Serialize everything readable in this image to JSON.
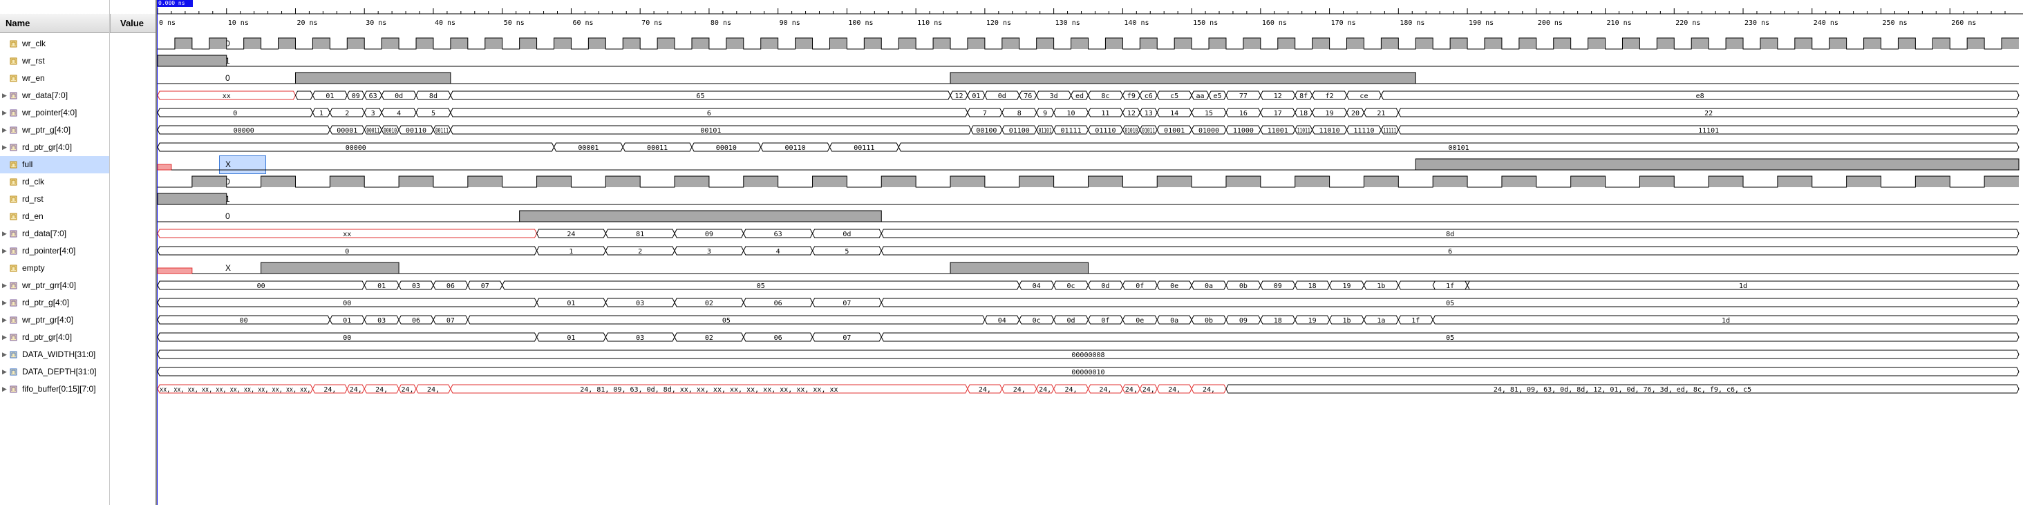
{
  "header": {
    "name_col": "Name",
    "value_col": "Value",
    "cursor_time": "0.000 ns"
  },
  "timeline": {
    "ticks": [
      "0 ns",
      "10 ns",
      "20 ns",
      "30 ns",
      "40 ns",
      "50 ns",
      "60 ns",
      "70 ns",
      "80 ns",
      "90 ns",
      "100 ns",
      "110 ns",
      "120 ns",
      "130 ns",
      "140 ns",
      "150 ns",
      "160 ns",
      "170 ns",
      "180 ns",
      "190 ns",
      "200 ns",
      "210 ns",
      "220 ns",
      "230 ns",
      "240 ns",
      "250 ns",
      "260 ns"
    ]
  },
  "signals": [
    {
      "name": "wr_clk",
      "value": "0",
      "kind": "clock",
      "half_period": 2.5,
      "start": 0,
      "expandable": false
    },
    {
      "name": "wr_rst",
      "value": "1",
      "kind": "bit",
      "segments": [
        [
          0,
          10,
          "1"
        ],
        [
          10,
          270,
          "0"
        ]
      ],
      "expandable": false
    },
    {
      "name": "wr_en",
      "value": "0",
      "kind": "bit",
      "segments": [
        [
          0,
          20,
          "0"
        ],
        [
          20,
          42.5,
          "1"
        ],
        [
          42.5,
          115,
          "0"
        ],
        [
          115,
          182.5,
          "1"
        ],
        [
          182.5,
          270,
          "0"
        ]
      ],
      "expandable": false
    },
    {
      "name": "wr_data[7:0]",
      "value": "XX",
      "kind": "bus",
      "expandable": true,
      "segments": [
        [
          0,
          20,
          "xx",
          true
        ],
        [
          20,
          22.5,
          "",
          false
        ],
        [
          22.5,
          27.5,
          "01"
        ],
        [
          27.5,
          30,
          "09"
        ],
        [
          30,
          32.5,
          "63"
        ],
        [
          32.5,
          37.5,
          "0d"
        ],
        [
          37.5,
          42.5,
          "8d"
        ],
        [
          42.5,
          115,
          "65"
        ],
        [
          115,
          117.5,
          "12"
        ],
        [
          117.5,
          120,
          "01"
        ],
        [
          120,
          125,
          "0d"
        ],
        [
          125,
          127.5,
          "76"
        ],
        [
          127.5,
          132.5,
          "3d"
        ],
        [
          132.5,
          135,
          "ed"
        ],
        [
          135,
          140,
          "8c"
        ],
        [
          140,
          142.5,
          "f9"
        ],
        [
          142.5,
          145,
          "c6"
        ],
        [
          145,
          150,
          "c5"
        ],
        [
          150,
          152.5,
          "aa"
        ],
        [
          152.5,
          155,
          "e5"
        ],
        [
          155,
          160,
          "77"
        ],
        [
          160,
          165,
          "12"
        ],
        [
          165,
          167.5,
          "8f"
        ],
        [
          167.5,
          172.5,
          "f2"
        ],
        [
          172.5,
          177.5,
          "ce"
        ],
        [
          177.5,
          270,
          "e8"
        ]
      ]
    },
    {
      "name": "wr_pointer[4:0]",
      "value": "0",
      "kind": "bus",
      "expandable": true,
      "segments": [
        [
          0,
          22.5,
          "0"
        ],
        [
          22.5,
          25,
          "1"
        ],
        [
          25,
          30,
          "2"
        ],
        [
          30,
          32.5,
          "3"
        ],
        [
          32.5,
          37.5,
          "4"
        ],
        [
          37.5,
          42.5,
          "5"
        ],
        [
          42.5,
          117.5,
          "6"
        ],
        [
          117.5,
          122.5,
          "7"
        ],
        [
          122.5,
          127.5,
          "8"
        ],
        [
          127.5,
          130,
          "9"
        ],
        [
          130,
          135,
          "10"
        ],
        [
          135,
          140,
          "11"
        ],
        [
          140,
          142.5,
          "12"
        ],
        [
          142.5,
          145,
          "13"
        ],
        [
          145,
          150,
          "14"
        ],
        [
          150,
          155,
          "15"
        ],
        [
          155,
          160,
          "16"
        ],
        [
          160,
          165,
          "17"
        ],
        [
          165,
          167.5,
          "18"
        ],
        [
          167.5,
          172.5,
          "19"
        ],
        [
          172.5,
          175,
          "20"
        ],
        [
          175,
          180,
          "21"
        ],
        [
          180,
          270,
          "22"
        ]
      ]
    },
    {
      "name": "wr_ptr_g[4:0]",
      "value": "00000",
      "kind": "bus",
      "expandable": true,
      "segments": [
        [
          0,
          25,
          "00000"
        ],
        [
          25,
          30,
          "00001"
        ],
        [
          30,
          32.5,
          "00011"
        ],
        [
          32.5,
          35,
          "00010"
        ],
        [
          35,
          40,
          "00110"
        ],
        [
          40,
          42.5,
          "00111"
        ],
        [
          42.5,
          118,
          "00101"
        ],
        [
          118,
          122.5,
          "00100"
        ],
        [
          122.5,
          127.5,
          "01100"
        ],
        [
          127.5,
          130,
          "01101"
        ],
        [
          130,
          135,
          "01111"
        ],
        [
          135,
          140,
          "01110"
        ],
        [
          140,
          142.5,
          "01010"
        ],
        [
          142.5,
          145,
          "01011"
        ],
        [
          145,
          150,
          "01001"
        ],
        [
          150,
          155,
          "01000"
        ],
        [
          155,
          160,
          "11000"
        ],
        [
          160,
          165,
          "11001"
        ],
        [
          165,
          167.5,
          "11011"
        ],
        [
          167.5,
          172.5,
          "11010"
        ],
        [
          172.5,
          177.5,
          "11110"
        ],
        [
          177.5,
          180,
          "11111"
        ],
        [
          180,
          270,
          "11101"
        ]
      ]
    },
    {
      "name": "rd_ptr_gr[4:0]",
      "value": "00000",
      "kind": "bus",
      "expandable": true,
      "segments": [
        [
          0,
          57.5,
          "00000"
        ],
        [
          57.5,
          67.5,
          "00001"
        ],
        [
          67.5,
          77.5,
          "00011"
        ],
        [
          77.5,
          87.5,
          "00010"
        ],
        [
          87.5,
          97.5,
          "00110"
        ],
        [
          97.5,
          107.5,
          "00111"
        ],
        [
          107.5,
          270,
          "00101"
        ]
      ]
    },
    {
      "name": "full",
      "value": "X",
      "kind": "bit",
      "selected": true,
      "expandable": false,
      "segments": [
        [
          0,
          2,
          "x"
        ],
        [
          2,
          182.5,
          "0"
        ],
        [
          182.5,
          270,
          "1"
        ]
      ]
    },
    {
      "name": "rd_clk",
      "value": "0",
      "kind": "clock",
      "half_period": 5,
      "start": 0,
      "expandable": false
    },
    {
      "name": "rd_rst",
      "value": "1",
      "kind": "bit",
      "segments": [
        [
          0,
          10,
          "1"
        ],
        [
          10,
          270,
          "0"
        ]
      ],
      "expandable": false
    },
    {
      "name": "rd_en",
      "value": "0",
      "kind": "bit",
      "segments": [
        [
          0,
          52.5,
          "0"
        ],
        [
          52.5,
          105,
          "1"
        ],
        [
          105,
          270,
          "0"
        ]
      ],
      "expandable": false
    },
    {
      "name": "rd_data[7:0]",
      "value": "XX",
      "kind": "bus",
      "expandable": true,
      "segments": [
        [
          0,
          55,
          "xx",
          true
        ],
        [
          55,
          65,
          "24"
        ],
        [
          65,
          75,
          "81"
        ],
        [
          75,
          85,
          "09"
        ],
        [
          85,
          95,
          "63"
        ],
        [
          95,
          105,
          "0d"
        ],
        [
          105,
          270,
          "8d"
        ]
      ]
    },
    {
      "name": "rd_pointer[4:0]",
      "value": "0",
      "kind": "bus",
      "expandable": true,
      "segments": [
        [
          0,
          55,
          "0"
        ],
        [
          55,
          65,
          "1"
        ],
        [
          65,
          75,
          "2"
        ],
        [
          75,
          85,
          "3"
        ],
        [
          85,
          95,
          "4"
        ],
        [
          95,
          105,
          "5"
        ],
        [
          105,
          270,
          "6"
        ]
      ]
    },
    {
      "name": "empty",
      "value": "X",
      "kind": "bit",
      "expandable": false,
      "segments": [
        [
          0,
          5,
          "x"
        ],
        [
          5,
          15,
          "0"
        ],
        [
          15,
          35,
          "1"
        ],
        [
          35,
          115,
          "0"
        ],
        [
          115,
          135,
          "1"
        ],
        [
          135,
          270,
          "0"
        ]
      ]
    },
    {
      "name": "wr_ptr_grr[4:0]",
      "value": "00",
      "kind": "bus",
      "expandable": true,
      "segments": [
        [
          0,
          30,
          "00"
        ],
        [
          30,
          35,
          "01"
        ],
        [
          35,
          40,
          "03"
        ],
        [
          40,
          45,
          "06"
        ],
        [
          45,
          50,
          "07"
        ],
        [
          50,
          125,
          "05"
        ],
        [
          125,
          130,
          "04"
        ],
        [
          130,
          135,
          "0c"
        ],
        [
          135,
          140,
          "0d"
        ],
        [
          140,
          145,
          "0f"
        ],
        [
          145,
          150,
          "0e"
        ],
        [
          150,
          155,
          "0a"
        ],
        [
          155,
          160,
          "0b"
        ],
        [
          160,
          165,
          "09"
        ],
        [
          165,
          170,
          "18"
        ],
        [
          170,
          175,
          "19"
        ],
        [
          175,
          180,
          "1b"
        ],
        [
          180,
          270,
          "1a"
        ],
        [
          185,
          190,
          "1f"
        ],
        [
          190,
          270,
          "1d"
        ]
      ]
    },
    {
      "name": "rd_ptr_g[4:0]",
      "value": "00",
      "kind": "bus",
      "expandable": true,
      "segments": [
        [
          0,
          55,
          "00"
        ],
        [
          55,
          65,
          "01"
        ],
        [
          65,
          75,
          "03"
        ],
        [
          75,
          85,
          "02"
        ],
        [
          85,
          95,
          "06"
        ],
        [
          95,
          105,
          "07"
        ],
        [
          105,
          270,
          "05"
        ]
      ]
    },
    {
      "name": "wr_ptr_gr[4:0]",
      "value": "00",
      "kind": "bus",
      "expandable": true,
      "segments": [
        [
          0,
          25,
          "00"
        ],
        [
          25,
          30,
          "01"
        ],
        [
          30,
          35,
          "03"
        ],
        [
          35,
          40,
          "06"
        ],
        [
          40,
          45,
          "07"
        ],
        [
          45,
          120,
          "05"
        ],
        [
          120,
          125,
          "04"
        ],
        [
          125,
          130,
          "0c"
        ],
        [
          130,
          135,
          "0d"
        ],
        [
          135,
          140,
          "0f"
        ],
        [
          140,
          145,
          "0e"
        ],
        [
          145,
          150,
          "0a"
        ],
        [
          150,
          155,
          "0b"
        ],
        [
          155,
          160,
          "09"
        ],
        [
          160,
          165,
          "18"
        ],
        [
          165,
          170,
          "19"
        ],
        [
          170,
          175,
          "1b"
        ],
        [
          175,
          180,
          "1a"
        ],
        [
          180,
          185,
          "1f"
        ],
        [
          185,
          270,
          "1d"
        ]
      ]
    },
    {
      "name": "rd_ptr_gr[4:0]",
      "value": "00",
      "kind": "bus",
      "expandable": true,
      "segments": [
        [
          0,
          55,
          "00"
        ],
        [
          55,
          65,
          "01"
        ],
        [
          65,
          75,
          "03"
        ],
        [
          75,
          85,
          "02"
        ],
        [
          85,
          95,
          "06"
        ],
        [
          95,
          105,
          "07"
        ],
        [
          105,
          270,
          "05"
        ]
      ]
    },
    {
      "name": "DATA_WIDTH[31:0]",
      "value": "00000008",
      "kind": "bus",
      "expandable": true,
      "param": true,
      "segments": [
        [
          0,
          270,
          "00000008"
        ]
      ]
    },
    {
      "name": "DATA_DEPTH[31:0]",
      "value": "00000010",
      "kind": "bus",
      "expandable": true,
      "param": true,
      "segments": [
        [
          0,
          270,
          "00000010"
        ]
      ]
    },
    {
      "name": "fifo_buffer[0:15][7:0]",
      "value": "XX,XX,XX,",
      "kind": "bus",
      "expandable": true,
      "segments": [
        [
          0,
          22.5,
          "xx, xx, xx, xx, xx, xx, xx, xx, xx, xx, xx,",
          true
        ],
        [
          22.5,
          27.5,
          "24,",
          true
        ],
        [
          27.5,
          30,
          "24,",
          true
        ],
        [
          30,
          35,
          "24,",
          true
        ],
        [
          35,
          37.5,
          "24,",
          true
        ],
        [
          37.5,
          42.5,
          "24,",
          true
        ],
        [
          42.5,
          117.5,
          "24, 81, 09, 63, 0d, 8d, xx, xx, xx, xx, xx, xx, xx, xx, xx, xx",
          true
        ],
        [
          117.5,
          122.5,
          "24,",
          true
        ],
        [
          122.5,
          127.5,
          "24,",
          true
        ],
        [
          127.5,
          130,
          "24,",
          true
        ],
        [
          130,
          135,
          "24,",
          true
        ],
        [
          135,
          140,
          "24,",
          true
        ],
        [
          140,
          142.5,
          "24,",
          true
        ],
        [
          142.5,
          145,
          "24,",
          true
        ],
        [
          145,
          150,
          "24,",
          true
        ],
        [
          150,
          155,
          "24,",
          true
        ],
        [
          155,
          270,
          "24, 81, 09, 63, 0d, 8d, 12, 01, 0d, 76, 3d, ed, 8c, f9, c6, c5",
          false
        ]
      ]
    }
  ]
}
